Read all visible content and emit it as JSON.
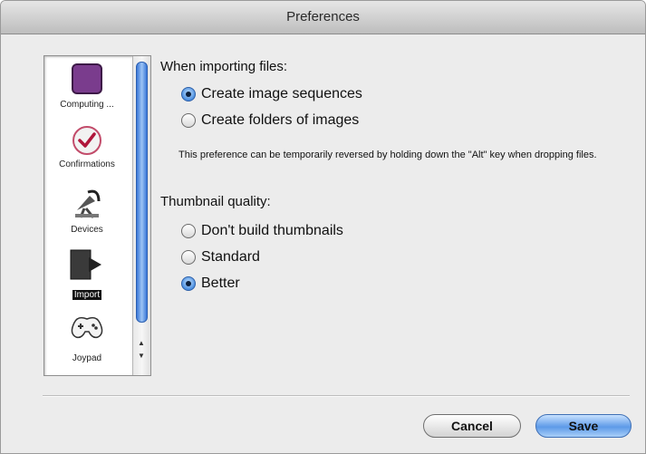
{
  "window": {
    "title": "Preferences"
  },
  "sidebar": {
    "items": [
      {
        "label": "Computing ...",
        "icon": "computing-icon",
        "selected": false
      },
      {
        "label": "Confirmations",
        "icon": "checkmark-icon",
        "selected": false
      },
      {
        "label": "Devices",
        "icon": "satellite-dish-icon",
        "selected": false
      },
      {
        "label": "Import",
        "icon": "import-arrow-icon",
        "selected": true
      },
      {
        "label": "Joypad",
        "icon": "gamepad-icon",
        "selected": false
      }
    ]
  },
  "import_section": {
    "heading": "When importing files:",
    "options": [
      {
        "label": "Create image sequences",
        "selected": true
      },
      {
        "label": "Create folders of images",
        "selected": false
      }
    ],
    "hint": "This preference can be temporarily reversed by holding down the \"Alt\" key when dropping files."
  },
  "thumbnail_section": {
    "heading": "Thumbnail quality:",
    "options": [
      {
        "label": "Don't build thumbnails",
        "selected": false
      },
      {
        "label": "Standard",
        "selected": false
      },
      {
        "label": "Better",
        "selected": true
      }
    ]
  },
  "buttons": {
    "cancel": "Cancel",
    "save": "Save"
  },
  "colors": {
    "accent": "#4d8fe0",
    "selection_bg": "#111111"
  }
}
